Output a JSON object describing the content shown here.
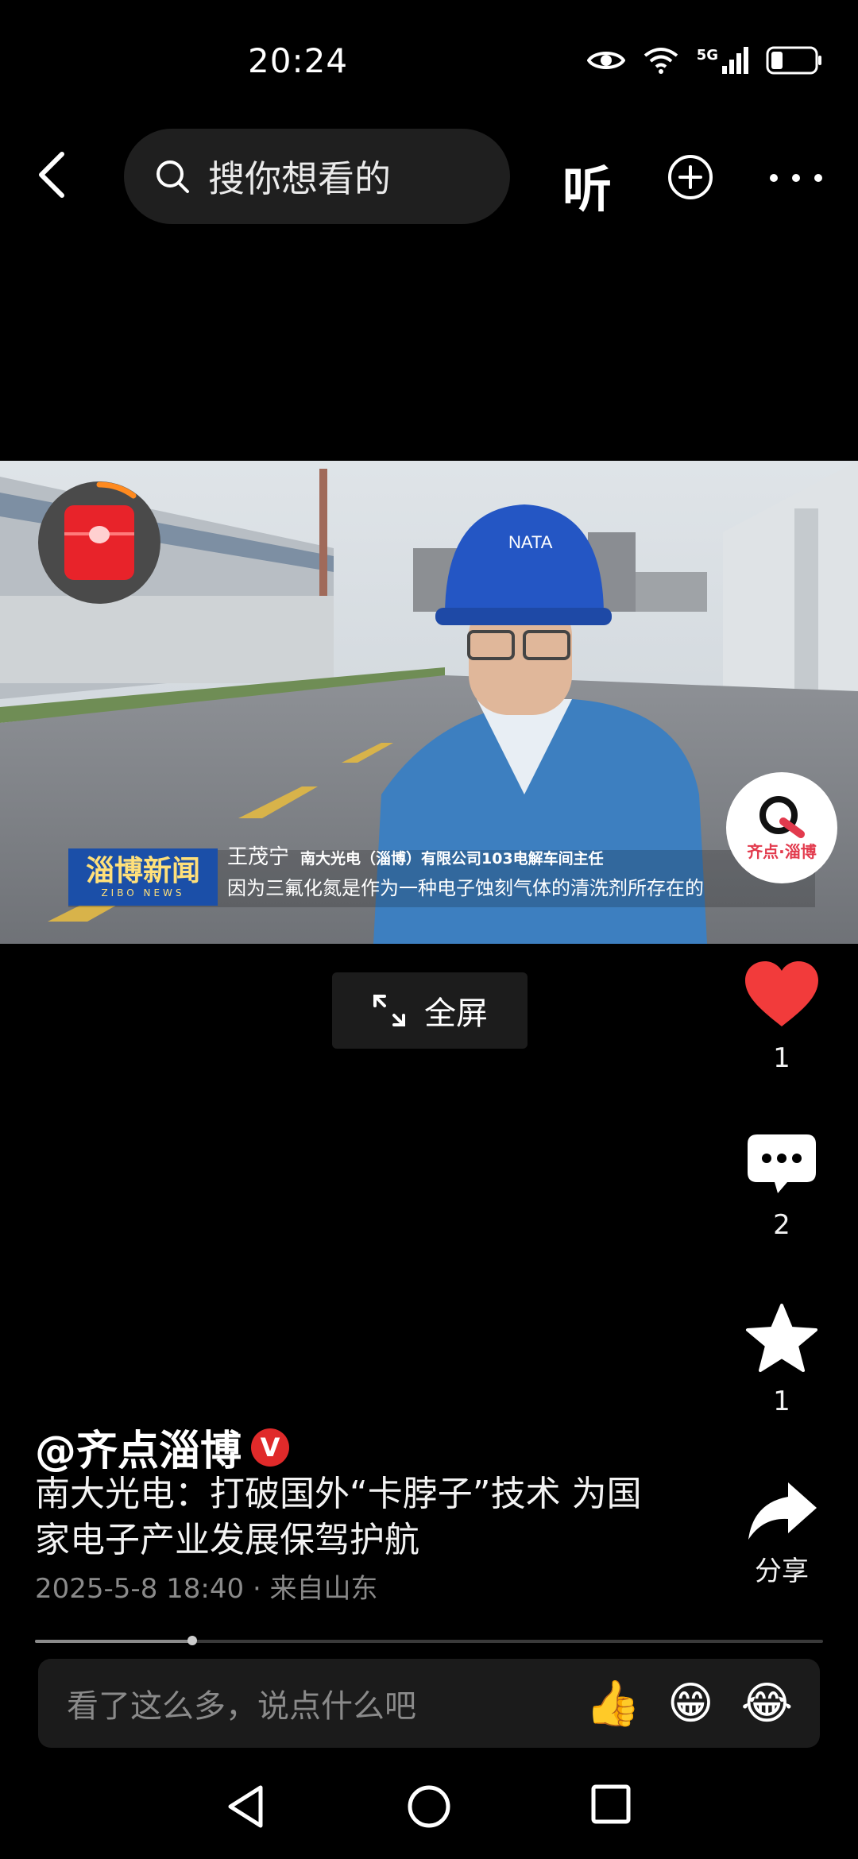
{
  "status_bar": {
    "time": "20:24",
    "network": "5G"
  },
  "nav": {
    "search_placeholder": "搜你想看的",
    "listen_label": "听"
  },
  "video": {
    "lower_third_name": "王茂宁",
    "lower_third_role": "南大光电（淄博）有限公司103电解车间主任",
    "caption": "因为三氟化氮是作为一种电子蚀刻气体的清洗剂所存在的",
    "channel_logo_main": "淄博新闻",
    "channel_logo_sub": "ZIBO NEWS",
    "watermark_text": "齐点·淄博",
    "helmet_text": "NATA"
  },
  "fullscreen_label": "全屏",
  "rail": {
    "likes": "1",
    "comments": "2",
    "favorites": "1",
    "share_label": "分享"
  },
  "post": {
    "author": "@齐点淄博",
    "verified_mark": "V",
    "title": "南大光电：打破国外“卡脖子”技术 为国家电子产业发展保驾护航",
    "date": "2025-5-8 18:40",
    "location": "· 来自山东"
  },
  "playback": {
    "progress": 0.2
  },
  "comment_bar": {
    "placeholder": "看了这么多，说点什么吧"
  },
  "emojis": [
    "👍",
    "😁",
    "😂"
  ],
  "colors": {
    "like": "#f23b3b",
    "background": "#000000",
    "verified": "#e02a2a"
  }
}
